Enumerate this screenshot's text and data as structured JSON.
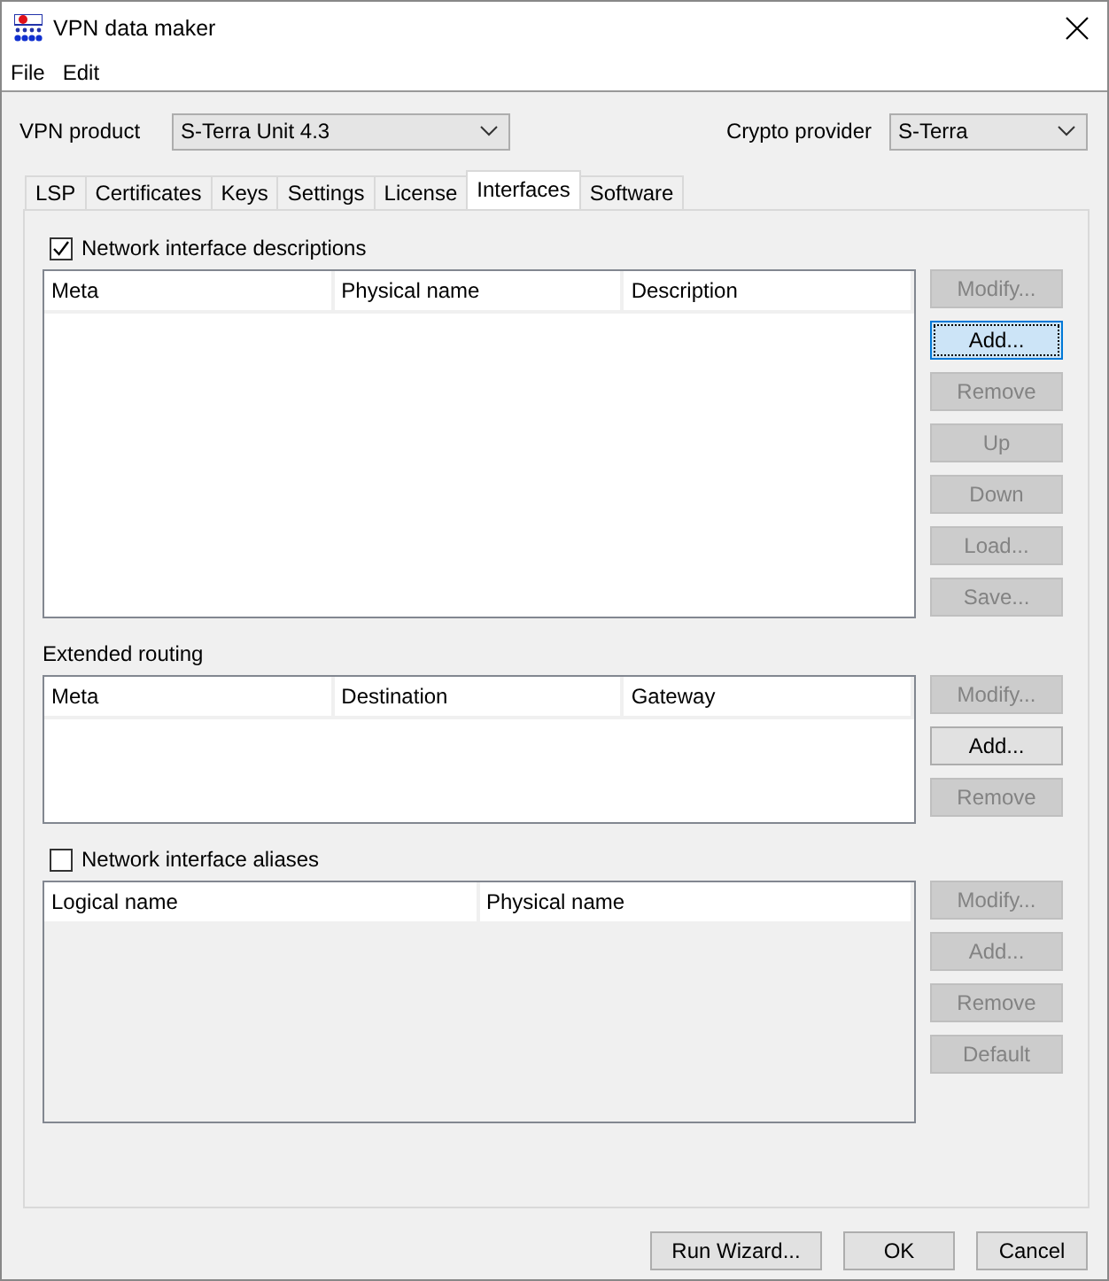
{
  "window": {
    "title": "VPN data maker"
  },
  "menu": [
    "File",
    "Edit"
  ],
  "product": {
    "label": "VPN product",
    "value": "S-Terra Unit 4.3"
  },
  "crypto": {
    "label": "Crypto provider",
    "value": "S-Terra"
  },
  "tabs": [
    {
      "label": "LSP",
      "selected": false
    },
    {
      "label": "Certificates",
      "selected": false
    },
    {
      "label": "Keys",
      "selected": false
    },
    {
      "label": "Settings",
      "selected": false
    },
    {
      "label": "License",
      "selected": false
    },
    {
      "label": "Interfaces",
      "selected": true
    },
    {
      "label": "Software",
      "selected": false
    }
  ],
  "sections": [
    {
      "kind": "checkbox",
      "label": "Network interface descriptions",
      "checked": true,
      "table": {
        "disabled": false,
        "columns": [
          "Meta",
          "Physical name",
          "Description"
        ]
      },
      "buttons": [
        {
          "label": "Modify...",
          "disabled": true,
          "focused": false
        },
        {
          "label": "Add...",
          "disabled": false,
          "focused": true
        },
        {
          "label": "Remove",
          "disabled": true,
          "focused": false
        },
        {
          "label": "Up",
          "disabled": true,
          "focused": false
        },
        {
          "label": "Down",
          "disabled": true,
          "focused": false
        },
        {
          "label": "Load...",
          "disabled": true,
          "focused": false
        },
        {
          "label": "Save...",
          "disabled": true,
          "focused": false
        }
      ]
    },
    {
      "kind": "label",
      "label": "Extended routing",
      "table": {
        "disabled": false,
        "columns": [
          "Meta",
          "Destination",
          "Gateway"
        ]
      },
      "buttons": [
        {
          "label": "Modify...",
          "disabled": true,
          "focused": false
        },
        {
          "label": "Add...",
          "disabled": false,
          "focused": false
        },
        {
          "label": "Remove",
          "disabled": true,
          "focused": false
        }
      ]
    },
    {
      "kind": "checkbox",
      "label": "Network interface aliases",
      "checked": false,
      "table": {
        "disabled": true,
        "columns": [
          "Logical name",
          "Physical name"
        ]
      },
      "buttons": [
        {
          "label": "Modify...",
          "disabled": true,
          "focused": false
        },
        {
          "label": "Add...",
          "disabled": true,
          "focused": false
        },
        {
          "label": "Remove",
          "disabled": true,
          "focused": false
        },
        {
          "label": "Default",
          "disabled": true,
          "focused": false
        }
      ]
    }
  ],
  "footer_buttons": [
    "Run Wizard...",
    "OK",
    "Cancel"
  ]
}
